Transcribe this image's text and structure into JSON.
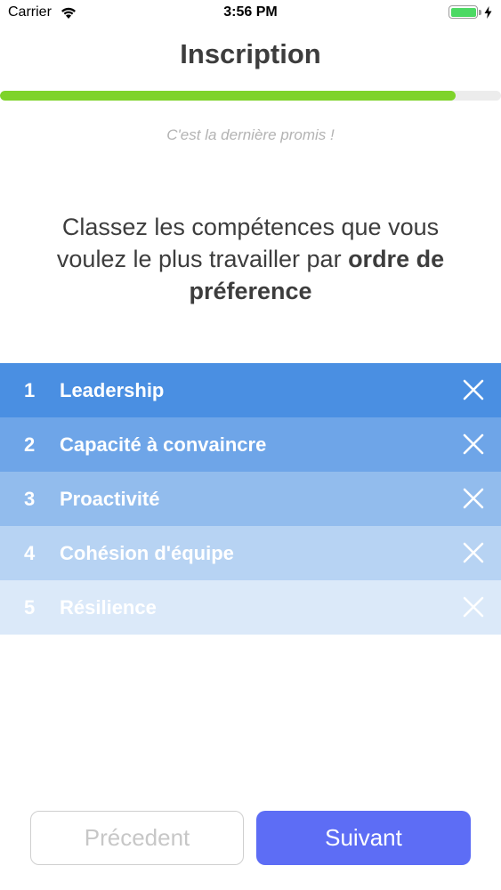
{
  "status_bar": {
    "carrier": "Carrier",
    "time": "3:56 PM",
    "battery_level": 1.0
  },
  "header": {
    "title": "Inscription",
    "progress": 0.91,
    "subtitle": "C'est la dernière promis !"
  },
  "prompt": {
    "text_start": "Classez les compétences que vous voulez le plus travailler par ",
    "text_bold": "ordre de préference"
  },
  "ranking": {
    "items": [
      {
        "rank": "1",
        "label": "Leadership",
        "color": "#4a8fe2"
      },
      {
        "rank": "2",
        "label": "Capacité à convaincre",
        "color": "#6ea5e8"
      },
      {
        "rank": "3",
        "label": "Proactivité",
        "color": "#92bced"
      },
      {
        "rank": "4",
        "label": "Cohésion d'équipe",
        "color": "#b7d3f3"
      },
      {
        "rank": "5",
        "label": "Résilience",
        "color": "#dbe9f9"
      }
    ],
    "remove_icon": "close-icon"
  },
  "footer": {
    "prev_label": "Précedent",
    "next_label": "Suivant"
  },
  "colors": {
    "accent": "#5d6df5",
    "progress": "#7ed32a"
  }
}
